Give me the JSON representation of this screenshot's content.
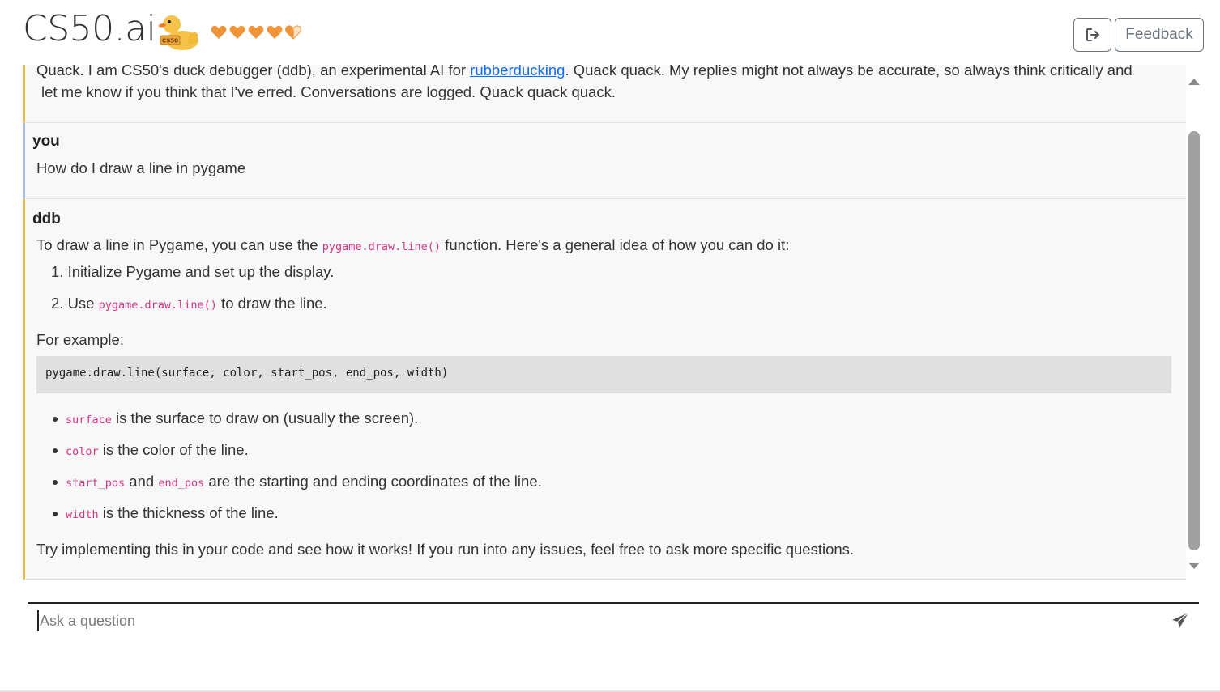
{
  "app": {
    "brand": "CS50.ai",
    "duck_label": "CS50",
    "hearts": [
      "full",
      "full",
      "full",
      "full",
      "partial"
    ],
    "heart_color": "#f0943a",
    "logout_icon": "logout-icon",
    "feedback_label": "Feedback"
  },
  "intro": {
    "line1_pre": "Quack. I am CS50's duck debugger (ddb), an experimental AI for ",
    "line1_link": "rubberducking",
    "line1_post": ". Quack quack. My replies might not always be accurate, so always think critically and",
    "line2": "let me know if you think that I've erred. Conversations are logged. Quack quack quack."
  },
  "user_msg": {
    "author": "you",
    "text": "How do I draw a line in pygame"
  },
  "bot_msg": {
    "author": "ddb",
    "p1_pre": "To draw a line in Pygame, you can use the ",
    "p1_code": "pygame.draw.line()",
    "p1_post": " function. Here's a general idea of how you can do it:",
    "step1": "1. Initialize Pygame and set up the display.",
    "step2_pre": "2. Use ",
    "step2_code": "pygame.draw.line()",
    "step2_post": " to draw the line.",
    "example_label": "For example:",
    "code": "pygame.draw.line(surface, color, start_pos, end_pos, width)",
    "b1_code": "surface",
    "b1_text": " is the surface to draw on (usually the screen).",
    "b2_code": "color",
    "b2_text": " is the color of the line.",
    "b3_code1": "start_pos",
    "b3_and": " and ",
    "b3_code2": "end_pos",
    "b3_text": " are the starting and ending coordinates of the line.",
    "b4_code": "width",
    "b4_text": " is the thickness of the line.",
    "closing": "Try implementing this in your code and see how it works! If you run into any issues, feel free to ask more specific questions."
  },
  "input": {
    "placeholder": "Ask a question",
    "send_icon": "send-icon"
  }
}
